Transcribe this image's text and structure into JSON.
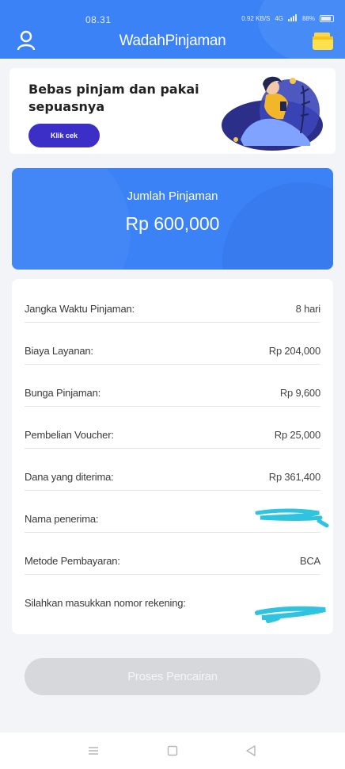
{
  "status_bar": {
    "time": "08.31",
    "net_speed": "0.92 KB/S",
    "network": "4G",
    "battery": "88%"
  },
  "header": {
    "title": "WadahPinjaman"
  },
  "banner": {
    "title": "Bebas pinjam dan pakai sepuasnya",
    "button_label": "Klik cek"
  },
  "amount": {
    "label": "Jumlah Pinjaman",
    "value": "Rp 600,000"
  },
  "details": {
    "rows": [
      {
        "label": "Jangka Waktu Pinjaman:",
        "value": "8 hari"
      },
      {
        "label": "Biaya Layanan:",
        "value": "Rp 204,000"
      },
      {
        "label": "Bunga Pinjaman:",
        "value": "Rp 9,600"
      },
      {
        "label": "Pembelian Voucher:",
        "value": "Rp 25,000"
      },
      {
        "label": "Dana yang diterima:",
        "value": "Rp 361,400"
      },
      {
        "label": "Nama penerima:",
        "value": ""
      },
      {
        "label": "Metode Pembayaran:",
        "value": "BCA"
      },
      {
        "label": "Silahkan masukkan nomor rekening:",
        "value": ""
      }
    ]
  },
  "submit": {
    "label": "Proses Pencairan"
  },
  "colors": {
    "primary": "#3b82f6",
    "banner_button": "#3c2fc7",
    "disabled_button": "#d6d8dc",
    "redaction": "#2ec3df"
  }
}
